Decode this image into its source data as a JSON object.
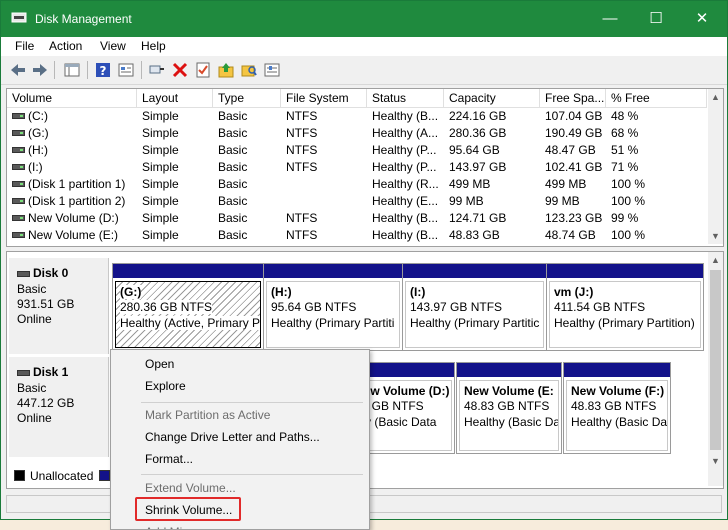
{
  "window": {
    "title": "Disk Management",
    "minimize": "—",
    "maximize": "☐",
    "close": "✕"
  },
  "menu": [
    "File",
    "Action",
    "View",
    "Help"
  ],
  "volume_list": {
    "columns": [
      "Volume",
      "Layout",
      "Type",
      "File System",
      "Status",
      "Capacity",
      "Free Spa...",
      "% Free"
    ],
    "rows": [
      [
        "(C:)",
        "Simple",
        "Basic",
        "NTFS",
        "Healthy (B...",
        "224.16 GB",
        "107.04 GB",
        "48 %"
      ],
      [
        "(G:)",
        "Simple",
        "Basic",
        "NTFS",
        "Healthy (A...",
        "280.36 GB",
        "190.49 GB",
        "68 %"
      ],
      [
        "(H:)",
        "Simple",
        "Basic",
        "NTFS",
        "Healthy (P...",
        "95.64 GB",
        "48.47 GB",
        "51 %"
      ],
      [
        "(I:)",
        "Simple",
        "Basic",
        "NTFS",
        "Healthy (P...",
        "143.97 GB",
        "102.41 GB",
        "71 %"
      ],
      [
        "(Disk 1 partition 1)",
        "Simple",
        "Basic",
        "",
        "Healthy (R...",
        "499 MB",
        "499 MB",
        "100 %"
      ],
      [
        "(Disk 1 partition 2)",
        "Simple",
        "Basic",
        "",
        "Healthy (E...",
        "99 MB",
        "99 MB",
        "100 %"
      ],
      [
        "New Volume (D:)",
        "Simple",
        "Basic",
        "NTFS",
        "Healthy (B...",
        "124.71 GB",
        "123.23 GB",
        "99 %"
      ],
      [
        "New Volume (E:)",
        "Simple",
        "Basic",
        "NTFS",
        "Healthy (B...",
        "48.83 GB",
        "48.74 GB",
        "100 %"
      ]
    ]
  },
  "disks": [
    {
      "name": "Disk 0",
      "type": "Basic",
      "size": "931.51 GB",
      "state": "Online",
      "partitions": [
        {
          "name": "(G:)",
          "size": "280.36 GB NTFS",
          "status": "Healthy (Active, Primary P"
        },
        {
          "name": "(H:)",
          "size": "95.64 GB NTFS",
          "status": "Healthy (Primary Partiti"
        },
        {
          "name": "(I:)",
          "size": "143.97 GB NTFS",
          "status": "Healthy (Primary Partitic"
        },
        {
          "name": "vm  (J:)",
          "size": "411.54 GB NTFS",
          "status": "Healthy (Primary Partition)"
        }
      ]
    },
    {
      "name": "Disk 1",
      "type": "Basic",
      "size": "447.12 GB",
      "state": "Online",
      "partitions": [
        {
          "name": "New Volume  (D:)",
          "size": "71 GB NTFS",
          "status": "thy (Basic Data"
        },
        {
          "name": "New Volume  (E:",
          "size": "48.83 GB NTFS",
          "status": "Healthy (Basic Da"
        },
        {
          "name": "New Volume  (F:)",
          "size": "48.83 GB NTFS",
          "status": "Healthy (Basic Da"
        }
      ]
    }
  ],
  "legend": {
    "unallocated": "Unallocated"
  },
  "context_menu": [
    {
      "label": "Open",
      "enabled": true
    },
    {
      "label": "Explore",
      "enabled": true
    },
    {
      "separator": true
    },
    {
      "label": "Mark Partition as Active",
      "enabled": false
    },
    {
      "label": "Change Drive Letter and Paths...",
      "enabled": true
    },
    {
      "label": "Format...",
      "enabled": true
    },
    {
      "separator": true
    },
    {
      "label": "Extend Volume...",
      "enabled": false
    },
    {
      "label": "Shrink Volume...",
      "enabled": true,
      "highlighted": true
    },
    {
      "label": "Add Mirror...",
      "enabled": false
    }
  ],
  "colors": {
    "title_bar": "#1f8a3e",
    "partition_bar": "#13128a",
    "highlight": "#e12a2a",
    "unallocated": "#000000",
    "primary": "#13128a"
  },
  "icons": [
    "back-arrow-icon",
    "forward-arrow-icon",
    "console-tree-icon",
    "help-icon",
    "properties-icon",
    "connect-icon",
    "delete-icon",
    "checklist-icon",
    "up-folder-icon",
    "search-folder-icon",
    "settings-icon"
  ]
}
